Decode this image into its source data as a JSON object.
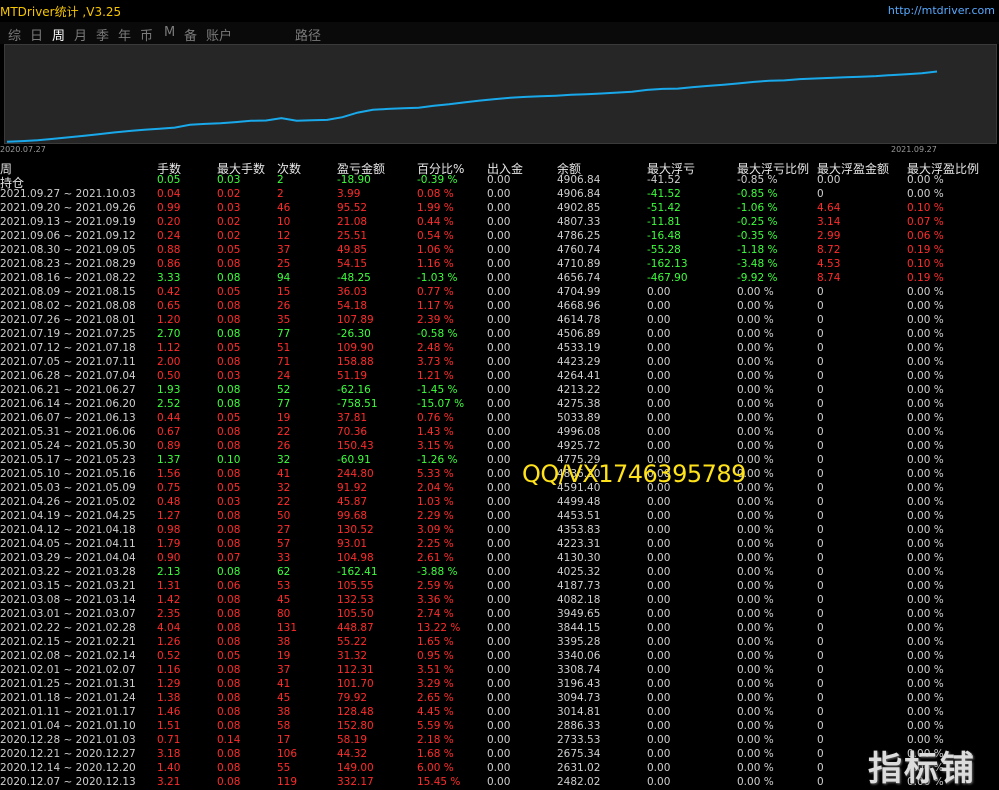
{
  "app": {
    "title": "MTDriver统计 ,V3.25",
    "link": "http://mtdriver.com",
    "watermark": "QQ/VX1746395789",
    "corner_logo": "指标铺"
  },
  "menu": {
    "items": [
      "综",
      "日",
      "周",
      "月",
      "季",
      "年",
      "币",
      "M",
      "备",
      "账户",
      "路径"
    ],
    "active": "周"
  },
  "chart_data": {
    "type": "line",
    "x_start_label": "2020.07.27",
    "x_end_label": "2021.09.27",
    "line_color": "#19a9ea",
    "ylim": [
      2000,
      5000
    ],
    "x": [
      "2020.07.27",
      "2020.08.03",
      "2020.08.10",
      "2020.08.17",
      "2020.08.24",
      "2020.08.31",
      "2020.09.07",
      "2020.09.14",
      "2020.09.21",
      "2020.09.28",
      "2020.10.05",
      "2020.10.12",
      "2020.10.19",
      "2020.10.26",
      "2020.11.02",
      "2020.11.09",
      "2020.11.16",
      "2020.11.23",
      "2020.11.30",
      "2020.12.07",
      "2020.12.14",
      "2020.12.21",
      "2020.12.28",
      "2021.01.04",
      "2021.01.11",
      "2021.01.18",
      "2021.01.25",
      "2021.02.01",
      "2021.02.08",
      "2021.02.15",
      "2021.02.22",
      "2021.03.01",
      "2021.03.08",
      "2021.03.15",
      "2021.03.22",
      "2021.03.29",
      "2021.04.05",
      "2021.04.12",
      "2021.04.19",
      "2021.04.26",
      "2021.05.03",
      "2021.05.10",
      "2021.05.17",
      "2021.05.24",
      "2021.05.31",
      "2021.06.07",
      "2021.06.14",
      "2021.06.21",
      "2021.06.28",
      "2021.07.05",
      "2021.07.12",
      "2021.07.19",
      "2021.07.26",
      "2021.08.02",
      "2021.08.09",
      "2021.08.16",
      "2021.08.23",
      "2021.08.30",
      "2021.09.06",
      "2021.09.13",
      "2021.09.20",
      "2021.09.27"
    ],
    "values": [
      2010,
      2030,
      2060,
      2100,
      2150,
      2200,
      2250,
      2310,
      2360,
      2400,
      2430,
      2470,
      2560,
      2590,
      2610,
      2650,
      2690,
      2700,
      2780,
      2696,
      2706,
      2720,
      2810,
      2960,
      3050,
      3080,
      3100,
      3120,
      3180,
      3230,
      3290,
      3350,
      3400,
      3440,
      3470,
      3490,
      3510,
      3540,
      3560,
      3580,
      3610,
      3640,
      3700,
      3730,
      3740,
      3790,
      3830,
      3870,
      3910,
      3960,
      4000,
      4010,
      4050,
      4070,
      4090,
      4110,
      4130,
      4150,
      4180,
      4210,
      4240,
      4300
    ]
  },
  "table": {
    "headers": [
      "周",
      "手数",
      "最大手数",
      "次数",
      "盈亏金额",
      "百分比%",
      "出入金",
      "余额",
      "最大浮亏",
      "最大浮亏比例",
      "最大浮盈金额",
      "最大浮盈比例"
    ],
    "subheader": "持仓",
    "rows": [
      {
        "period": "持仓",
        "lots": "0.05",
        "max_lots": "0.03",
        "count": "2",
        "pl": "-18.90",
        "pct": "-0.39 %",
        "io": "0.00",
        "bal": "4906.84",
        "mdd": "-41.52",
        "mdd_pct": "-0.85 %",
        "mfp": "0.00",
        "mfp_pct": "0.00 %",
        "sign": "neg",
        "hide_period": true
      },
      {
        "period": "2021.09.27 ~ 2021.10.03",
        "lots": "0.04",
        "max_lots": "0.02",
        "count": "2",
        "pl": "3.99",
        "pct": "0.08 %",
        "io": "0.00",
        "bal": "4906.84",
        "mdd": "-41.52",
        "mdd_pct": "-0.85 %",
        "mfp": "0",
        "mfp_pct": "0.00 %",
        "sign": "pos",
        "mdd_green": true
      },
      {
        "period": "2021.09.20 ~ 2021.09.26",
        "lots": "0.99",
        "max_lots": "0.03",
        "count": "46",
        "pl": "95.52",
        "pct": "1.99 %",
        "io": "0.00",
        "bal": "4902.85",
        "mdd": "-51.42",
        "mdd_pct": "-1.06 %",
        "mfp": "4.64",
        "mfp_pct": "0.10 %",
        "sign": "pos",
        "mdd_green": true,
        "mfp_red": true
      },
      {
        "period": "2021.09.13 ~ 2021.09.19",
        "lots": "0.20",
        "max_lots": "0.02",
        "count": "10",
        "pl": "21.08",
        "pct": "0.44 %",
        "io": "0.00",
        "bal": "4807.33",
        "mdd": "-11.81",
        "mdd_pct": "-0.25 %",
        "mfp": "3.14",
        "mfp_pct": "0.07 %",
        "sign": "pos",
        "mdd_green": true,
        "mfp_red": true
      },
      {
        "period": "2021.09.06 ~ 2021.09.12",
        "lots": "0.24",
        "max_lots": "0.02",
        "count": "12",
        "pl": "25.51",
        "pct": "0.54 %",
        "io": "0.00",
        "bal": "4786.25",
        "mdd": "-16.48",
        "mdd_pct": "-0.35 %",
        "mfp": "2.99",
        "mfp_pct": "0.06 %",
        "sign": "pos",
        "mdd_green": true,
        "mfp_red": true
      },
      {
        "period": "2021.08.30 ~ 2021.09.05",
        "lots": "0.88",
        "max_lots": "0.05",
        "count": "37",
        "pl": "49.85",
        "pct": "1.06 %",
        "io": "0.00",
        "bal": "4760.74",
        "mdd": "-55.28",
        "mdd_pct": "-1.18 %",
        "mfp": "8.72",
        "mfp_pct": "0.19 %",
        "sign": "pos",
        "mdd_green": true,
        "mfp_red": true
      },
      {
        "period": "2021.08.23 ~ 2021.08.29",
        "lots": "0.86",
        "max_lots": "0.08",
        "count": "25",
        "pl": "54.15",
        "pct": "1.16 %",
        "io": "0.00",
        "bal": "4710.89",
        "mdd": "-162.13",
        "mdd_pct": "-3.48 %",
        "mfp": "4.53",
        "mfp_pct": "0.10 %",
        "sign": "pos",
        "mdd_green": true,
        "mfp_red": true
      },
      {
        "period": "2021.08.16 ~ 2021.08.22",
        "lots": "3.33",
        "max_lots": "0.08",
        "count": "94",
        "pl": "-48.25",
        "pct": "-1.03 %",
        "io": "0.00",
        "bal": "4656.74",
        "mdd": "-467.90",
        "mdd_pct": "-9.92 %",
        "mfp": "8.74",
        "mfp_pct": "0.19 %",
        "sign": "neg",
        "mdd_green": true,
        "mfp_red": true
      },
      {
        "period": "2021.08.09 ~ 2021.08.15",
        "lots": "0.42",
        "max_lots": "0.05",
        "count": "15",
        "pl": "36.03",
        "pct": "0.77 %",
        "io": "0.00",
        "bal": "4704.99",
        "mdd": "0.00",
        "mdd_pct": "0.00 %",
        "mfp": "0",
        "mfp_pct": "0.00 %",
        "sign": "pos"
      },
      {
        "period": "2021.08.02 ~ 2021.08.08",
        "lots": "0.65",
        "max_lots": "0.08",
        "count": "26",
        "pl": "54.18",
        "pct": "1.17 %",
        "io": "0.00",
        "bal": "4668.96",
        "mdd": "0.00",
        "mdd_pct": "0.00 %",
        "mfp": "0",
        "mfp_pct": "0.00 %",
        "sign": "pos"
      },
      {
        "period": "2021.07.26 ~ 2021.08.01",
        "lots": "1.20",
        "max_lots": "0.08",
        "count": "35",
        "pl": "107.89",
        "pct": "2.39 %",
        "io": "0.00",
        "bal": "4614.78",
        "mdd": "0.00",
        "mdd_pct": "0.00 %",
        "mfp": "0",
        "mfp_pct": "0.00 %",
        "sign": "pos"
      },
      {
        "period": "2021.07.19 ~ 2021.07.25",
        "lots": "2.70",
        "max_lots": "0.08",
        "count": "77",
        "pl": "-26.30",
        "pct": "-0.58 %",
        "io": "0.00",
        "bal": "4506.89",
        "mdd": "0.00",
        "mdd_pct": "0.00 %",
        "mfp": "0",
        "mfp_pct": "0.00 %",
        "sign": "neg"
      },
      {
        "period": "2021.07.12 ~ 2021.07.18",
        "lots": "1.12",
        "max_lots": "0.05",
        "count": "51",
        "pl": "109.90",
        "pct": "2.48 %",
        "io": "0.00",
        "bal": "4533.19",
        "mdd": "0.00",
        "mdd_pct": "0.00 %",
        "mfp": "0",
        "mfp_pct": "0.00 %",
        "sign": "pos"
      },
      {
        "period": "2021.07.05 ~ 2021.07.11",
        "lots": "2.00",
        "max_lots": "0.08",
        "count": "71",
        "pl": "158.88",
        "pct": "3.73 %",
        "io": "0.00",
        "bal": "4423.29",
        "mdd": "0.00",
        "mdd_pct": "0.00 %",
        "mfp": "0",
        "mfp_pct": "0.00 %",
        "sign": "pos"
      },
      {
        "period": "2021.06.28 ~ 2021.07.04",
        "lots": "0.50",
        "max_lots": "0.03",
        "count": "24",
        "pl": "51.19",
        "pct": "1.21 %",
        "io": "0.00",
        "bal": "4264.41",
        "mdd": "0.00",
        "mdd_pct": "0.00 %",
        "mfp": "0",
        "mfp_pct": "0.00 %",
        "sign": "pos"
      },
      {
        "period": "2021.06.21 ~ 2021.06.27",
        "lots": "1.93",
        "max_lots": "0.08",
        "count": "52",
        "pl": "-62.16",
        "pct": "-1.45 %",
        "io": "0.00",
        "bal": "4213.22",
        "mdd": "0.00",
        "mdd_pct": "0.00 %",
        "mfp": "0",
        "mfp_pct": "0.00 %",
        "sign": "neg"
      },
      {
        "period": "2021.06.14 ~ 2021.06.20",
        "lots": "2.52",
        "max_lots": "0.08",
        "count": "77",
        "pl": "-758.51",
        "pct": "-15.07 %",
        "io": "0.00",
        "bal": "4275.38",
        "mdd": "0.00",
        "mdd_pct": "0.00 %",
        "mfp": "0",
        "mfp_pct": "0.00 %",
        "sign": "neg"
      },
      {
        "period": "2021.06.07 ~ 2021.06.13",
        "lots": "0.44",
        "max_lots": "0.05",
        "count": "19",
        "pl": "37.81",
        "pct": "0.76 %",
        "io": "0.00",
        "bal": "5033.89",
        "mdd": "0.00",
        "mdd_pct": "0.00 %",
        "mfp": "0",
        "mfp_pct": "0.00 %",
        "sign": "pos"
      },
      {
        "period": "2021.05.31 ~ 2021.06.06",
        "lots": "0.67",
        "max_lots": "0.08",
        "count": "22",
        "pl": "70.36",
        "pct": "1.43 %",
        "io": "0.00",
        "bal": "4996.08",
        "mdd": "0.00",
        "mdd_pct": "0.00 %",
        "mfp": "0",
        "mfp_pct": "0.00 %",
        "sign": "pos"
      },
      {
        "period": "2021.05.24 ~ 2021.05.30",
        "lots": "0.89",
        "max_lots": "0.08",
        "count": "26",
        "pl": "150.43",
        "pct": "3.15 %",
        "io": "0.00",
        "bal": "4925.72",
        "mdd": "0.00",
        "mdd_pct": "0.00 %",
        "mfp": "0",
        "mfp_pct": "0.00 %",
        "sign": "pos"
      },
      {
        "period": "2021.05.17 ~ 2021.05.23",
        "lots": "1.37",
        "max_lots": "0.10",
        "count": "32",
        "pl": "-60.91",
        "pct": "-1.26 %",
        "io": "0.00",
        "bal": "4775.29",
        "mdd": "0.00",
        "mdd_pct": "0.00 %",
        "mfp": "0",
        "mfp_pct": "0.00 %",
        "sign": "neg"
      },
      {
        "period": "2021.05.10 ~ 2021.05.16",
        "lots": "1.56",
        "max_lots": "0.08",
        "count": "41",
        "pl": "244.80",
        "pct": "5.33 %",
        "io": "0.00",
        "bal": "4836.20",
        "mdd": "0.00",
        "mdd_pct": "0.00 %",
        "mfp": "0",
        "mfp_pct": "0.00 %",
        "sign": "pos"
      },
      {
        "period": "2021.05.03 ~ 2021.05.09",
        "lots": "0.75",
        "max_lots": "0.05",
        "count": "32",
        "pl": "91.92",
        "pct": "2.04 %",
        "io": "0.00",
        "bal": "4591.40",
        "mdd": "0.00",
        "mdd_pct": "0.00 %",
        "mfp": "0",
        "mfp_pct": "0.00 %",
        "sign": "pos"
      },
      {
        "period": "2021.04.26 ~ 2021.05.02",
        "lots": "0.48",
        "max_lots": "0.03",
        "count": "22",
        "pl": "45.87",
        "pct": "1.03 %",
        "io": "0.00",
        "bal": "4499.48",
        "mdd": "0.00",
        "mdd_pct": "0.00 %",
        "mfp": "0",
        "mfp_pct": "0.00 %",
        "sign": "pos"
      },
      {
        "period": "2021.04.19 ~ 2021.04.25",
        "lots": "1.27",
        "max_lots": "0.08",
        "count": "50",
        "pl": "99.68",
        "pct": "2.29 %",
        "io": "0.00",
        "bal": "4453.51",
        "mdd": "0.00",
        "mdd_pct": "0.00 %",
        "mfp": "0",
        "mfp_pct": "0.00 %",
        "sign": "pos"
      },
      {
        "period": "2021.04.12 ~ 2021.04.18",
        "lots": "0.98",
        "max_lots": "0.08",
        "count": "27",
        "pl": "130.52",
        "pct": "3.09 %",
        "io": "0.00",
        "bal": "4353.83",
        "mdd": "0.00",
        "mdd_pct": "0.00 %",
        "mfp": "0",
        "mfp_pct": "0.00 %",
        "sign": "pos"
      },
      {
        "period": "2021.04.05 ~ 2021.04.11",
        "lots": "1.79",
        "max_lots": "0.08",
        "count": "57",
        "pl": "93.01",
        "pct": "2.25 %",
        "io": "0.00",
        "bal": "4223.31",
        "mdd": "0.00",
        "mdd_pct": "0.00 %",
        "mfp": "0",
        "mfp_pct": "0.00 %",
        "sign": "pos"
      },
      {
        "period": "2021.03.29 ~ 2021.04.04",
        "lots": "0.90",
        "max_lots": "0.07",
        "count": "33",
        "pl": "104.98",
        "pct": "2.61 %",
        "io": "0.00",
        "bal": "4130.30",
        "mdd": "0.00",
        "mdd_pct": "0.00 %",
        "mfp": "0",
        "mfp_pct": "0.00 %",
        "sign": "pos"
      },
      {
        "period": "2021.03.22 ~ 2021.03.28",
        "lots": "2.13",
        "max_lots": "0.08",
        "count": "62",
        "pl": "-162.41",
        "pct": "-3.88 %",
        "io": "0.00",
        "bal": "4025.32",
        "mdd": "0.00",
        "mdd_pct": "0.00 %",
        "mfp": "0",
        "mfp_pct": "0.00 %",
        "sign": "neg"
      },
      {
        "period": "2021.03.15 ~ 2021.03.21",
        "lots": "1.31",
        "max_lots": "0.06",
        "count": "53",
        "pl": "105.55",
        "pct": "2.59 %",
        "io": "0.00",
        "bal": "4187.73",
        "mdd": "0.00",
        "mdd_pct": "0.00 %",
        "mfp": "0",
        "mfp_pct": "0.00 %",
        "sign": "pos"
      },
      {
        "period": "2021.03.08 ~ 2021.03.14",
        "lots": "1.42",
        "max_lots": "0.08",
        "count": "45",
        "pl": "132.53",
        "pct": "3.36 %",
        "io": "0.00",
        "bal": "4082.18",
        "mdd": "0.00",
        "mdd_pct": "0.00 %",
        "mfp": "0",
        "mfp_pct": "0.00 %",
        "sign": "pos"
      },
      {
        "period": "2021.03.01 ~ 2021.03.07",
        "lots": "2.35",
        "max_lots": "0.08",
        "count": "80",
        "pl": "105.50",
        "pct": "2.74 %",
        "io": "0.00",
        "bal": "3949.65",
        "mdd": "0.00",
        "mdd_pct": "0.00 %",
        "mfp": "0",
        "mfp_pct": "0.00 %",
        "sign": "pos"
      },
      {
        "period": "2021.02.22 ~ 2021.02.28",
        "lots": "4.04",
        "max_lots": "0.08",
        "count": "131",
        "pl": "448.87",
        "pct": "13.22 %",
        "io": "0.00",
        "bal": "3844.15",
        "mdd": "0.00",
        "mdd_pct": "0.00 %",
        "mfp": "0",
        "mfp_pct": "0.00 %",
        "sign": "pos"
      },
      {
        "period": "2021.02.15 ~ 2021.02.21",
        "lots": "1.26",
        "max_lots": "0.08",
        "count": "38",
        "pl": "55.22",
        "pct": "1.65 %",
        "io": "0.00",
        "bal": "3395.28",
        "mdd": "0.00",
        "mdd_pct": "0.00 %",
        "mfp": "0",
        "mfp_pct": "0.00 %",
        "sign": "pos"
      },
      {
        "period": "2021.02.08 ~ 2021.02.14",
        "lots": "0.52",
        "max_lots": "0.05",
        "count": "19",
        "pl": "31.32",
        "pct": "0.95 %",
        "io": "0.00",
        "bal": "3340.06",
        "mdd": "0.00",
        "mdd_pct": "0.00 %",
        "mfp": "0",
        "mfp_pct": "0.00 %",
        "sign": "pos"
      },
      {
        "period": "2021.02.01 ~ 2021.02.07",
        "lots": "1.16",
        "max_lots": "0.08",
        "count": "37",
        "pl": "112.31",
        "pct": "3.51 %",
        "io": "0.00",
        "bal": "3308.74",
        "mdd": "0.00",
        "mdd_pct": "0.00 %",
        "mfp": "0",
        "mfp_pct": "0.00 %",
        "sign": "pos"
      },
      {
        "period": "2021.01.25 ~ 2021.01.31",
        "lots": "1.29",
        "max_lots": "0.08",
        "count": "41",
        "pl": "101.70",
        "pct": "3.29 %",
        "io": "0.00",
        "bal": "3196.43",
        "mdd": "0.00",
        "mdd_pct": "0.00 %",
        "mfp": "0",
        "mfp_pct": "0.00 %",
        "sign": "pos"
      },
      {
        "period": "2021.01.18 ~ 2021.01.24",
        "lots": "1.38",
        "max_lots": "0.08",
        "count": "45",
        "pl": "79.92",
        "pct": "2.65 %",
        "io": "0.00",
        "bal": "3094.73",
        "mdd": "0.00",
        "mdd_pct": "0.00 %",
        "mfp": "0",
        "mfp_pct": "0.00 %",
        "sign": "pos"
      },
      {
        "period": "2021.01.11 ~ 2021.01.17",
        "lots": "1.46",
        "max_lots": "0.08",
        "count": "38",
        "pl": "128.48",
        "pct": "4.45 %",
        "io": "0.00",
        "bal": "3014.81",
        "mdd": "0.00",
        "mdd_pct": "0.00 %",
        "mfp": "0",
        "mfp_pct": "0.00 %",
        "sign": "pos"
      },
      {
        "period": "2021.01.04 ~ 2021.01.10",
        "lots": "1.51",
        "max_lots": "0.08",
        "count": "58",
        "pl": "152.80",
        "pct": "5.59 %",
        "io": "0.00",
        "bal": "2886.33",
        "mdd": "0.00",
        "mdd_pct": "0.00 %",
        "mfp": "0",
        "mfp_pct": "0.00 %",
        "sign": "pos"
      },
      {
        "period": "2020.12.28 ~ 2021.01.03",
        "lots": "0.71",
        "max_lots": "0.14",
        "count": "17",
        "pl": "58.19",
        "pct": "2.18 %",
        "io": "0.00",
        "bal": "2733.53",
        "mdd": "0.00",
        "mdd_pct": "0.00 %",
        "mfp": "0",
        "mfp_pct": "0.00 %",
        "sign": "pos"
      },
      {
        "period": "2020.12.21 ~ 2020.12.27",
        "lots": "3.18",
        "max_lots": "0.08",
        "count": "106",
        "pl": "44.32",
        "pct": "1.68 %",
        "io": "0.00",
        "bal": "2675.34",
        "mdd": "0.00",
        "mdd_pct": "0.00 %",
        "mfp": "0",
        "mfp_pct": "0.00 %",
        "sign": "pos"
      },
      {
        "period": "2020.12.14 ~ 2020.12.20",
        "lots": "1.40",
        "max_lots": "0.08",
        "count": "55",
        "pl": "149.00",
        "pct": "6.00 %",
        "io": "0.00",
        "bal": "2631.02",
        "mdd": "0.00",
        "mdd_pct": "0.00 %",
        "mfp": "0",
        "mfp_pct": "0.00 %",
        "sign": "pos"
      },
      {
        "period": "2020.12.07 ~ 2020.12.13",
        "lots": "3.21",
        "max_lots": "0.08",
        "count": "119",
        "pl": "332.17",
        "pct": "15.45 %",
        "io": "0.00",
        "bal": "2482.02",
        "mdd": "0.00",
        "mdd_pct": "0.00 %",
        "mfp": "0",
        "mfp_pct": "0.00 %",
        "sign": "pos"
      }
    ]
  }
}
